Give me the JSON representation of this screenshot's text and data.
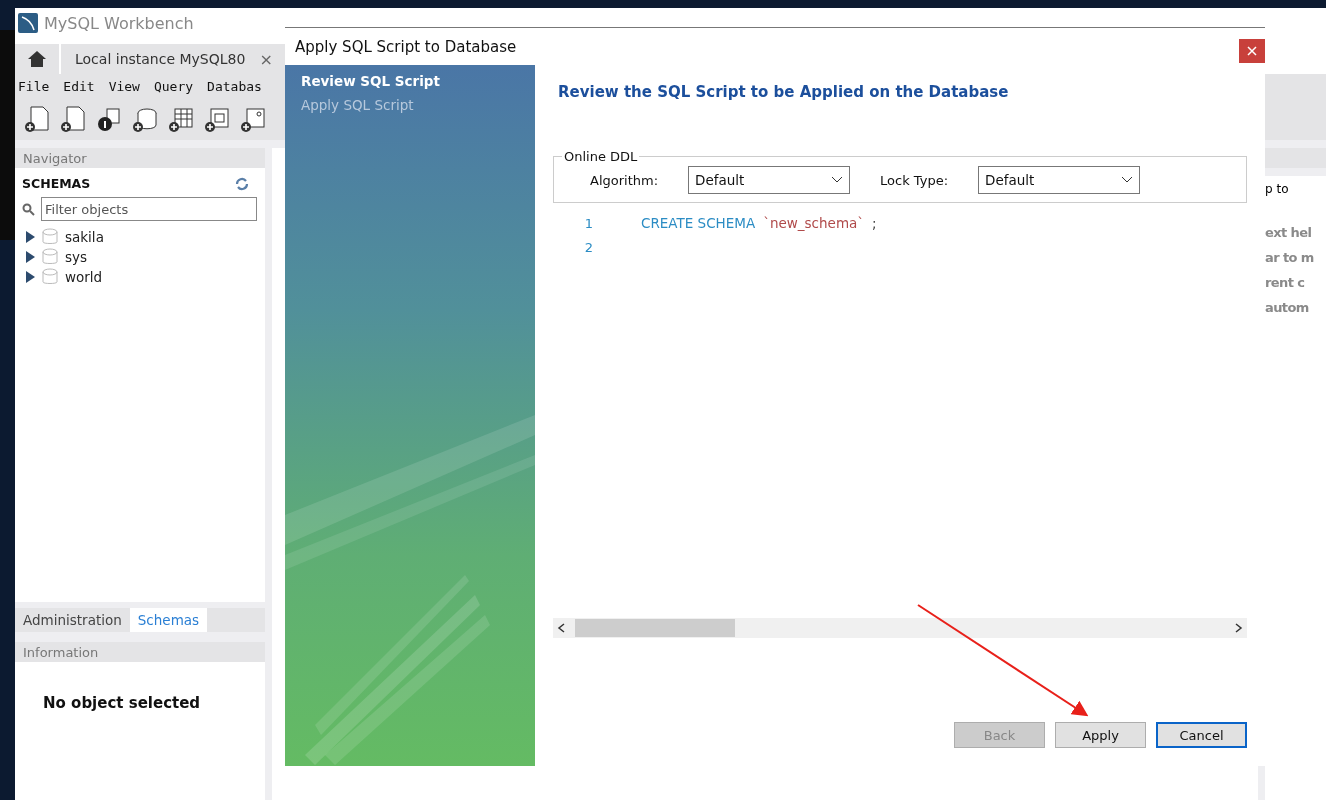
{
  "workbench": {
    "title": "MySQL Workbench",
    "tabs": [
      {
        "label": "Local instance MySQL80",
        "close": "×"
      }
    ],
    "menu": [
      "File",
      "Edit",
      "View",
      "Query",
      "Databas"
    ],
    "navigator": {
      "title": "Navigator",
      "section": "SCHEMAS",
      "filter_placeholder": "Filter objects",
      "schemas": [
        {
          "name": "sakila",
          "expanded": false
        },
        {
          "name": "sys",
          "expanded": false
        },
        {
          "name": "world",
          "expanded": false
        }
      ]
    },
    "bottom_tabs": [
      {
        "label": "Administration",
        "selected": false
      },
      {
        "label": "Schemas",
        "selected": true
      }
    ],
    "information": {
      "title": "Information",
      "message": "No object selected"
    },
    "right_panel": {
      "jump_label": "p to",
      "help_lines": [
        "ext hel",
        "ar to m",
        "rent c",
        "autom"
      ]
    }
  },
  "dialog": {
    "title": "Apply SQL Script to Database",
    "steps": [
      {
        "label": "Review SQL Script",
        "selected": true
      },
      {
        "label": "Apply SQL Script",
        "selected": false
      }
    ],
    "heading": "Review the SQL Script to be Applied on the Database",
    "online_ddl": {
      "title": "Online DDL",
      "algorithm": {
        "label": "Algorithm:",
        "value": "Default"
      },
      "lock_type": {
        "label": "Lock Type:",
        "value": "Default"
      }
    },
    "script": [
      {
        "number": "1",
        "tokens": [
          {
            "kind": "keyword",
            "text": "CREATE SCHEMA"
          },
          {
            "kind": "identifier",
            "text": "`new_schema`"
          },
          {
            "kind": "plain",
            "text": ";"
          }
        ]
      },
      {
        "number": "2"
      }
    ],
    "buttons": [
      {
        "label": "Back",
        "disabled": true,
        "default": false
      },
      {
        "label": "Apply",
        "disabled": false,
        "default": false
      },
      {
        "label": "Cancel",
        "disabled": false,
        "default": true
      }
    ]
  }
}
